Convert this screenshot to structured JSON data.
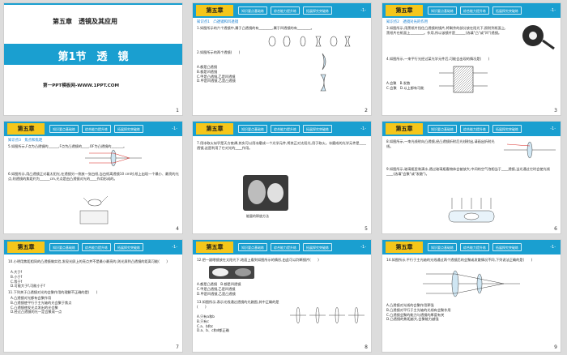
{
  "common": {
    "chapter_badge": "第五章",
    "tab1": "知识要点基础练",
    "tab2": "综合能力提升练",
    "tab3": "拓展探究突破练",
    "page_marker": "-1-"
  },
  "slides": [
    {
      "number": "1",
      "chapter_title": "第五章　透镜及其应用",
      "section_title": "第1节　透　镜",
      "footer": "第一PPT模板网-WWW.1PPT.COM"
    },
    {
      "number": "2",
      "topic": "知识点1　凸透镜和凹透镜",
      "q1": "1.如图所示的六个透镜中,属于凸透镜的有________,属于凹透镜的有________。",
      "q2": "2.如图所示的两个透镜(　　)",
      "opts": "A.都是凸透镜\nB.都是凹透镜\nC.甲是凸透镜,乙是凹透镜\nD.甲是凹透镜,乙是凸透镜"
    },
    {
      "number": "3",
      "topic": "知识点2　透镜对光的作用",
      "q3": "3.如图所示,用黑纸片挡住凸透镜的镜片,将剩余的部分放在阳光下,照射到纸面上,黑纸片在纸面上________。作用,所以该镜片是______(选填\"凸\"或\"凹\")透镜。",
      "q4": "4.如图所示,一束平行光经过某光学元件后,可能会出现的情况是(　　)",
      "opts": "A.会聚　B.发散\nC.会聚　D.以上都有可能"
    },
    {
      "number": "4",
      "topic": "知识点3　焦点和焦距",
      "q5": "5.如图所示,F点为凸透镜的______,F点为凸透镜的____,OF为凸透镜的_______。",
      "q6": "6.如图所示,用凸透镜正对着太阳光,在透镜另一侧放一张白纸,当白纸离透镜10 cm时,纸上出现一个最小、最亮的光点,则透镜的焦距约为______cm,光点是由凸透镜对光的____作用形成的。"
    },
    {
      "number": "5",
      "q7": "7.用冰取火似乎是天方夜谭,其实可以用冰磨成一个光学元件,将其正对太阳光,用于取火。冰磨成的光学元件是____透镜,这是利用了它对光的____作用。",
      "caption": "能量的释放方法"
    },
    {
      "number": "6",
      "q8": "8.如图所示,一束光线射向凸透镜,经凸透镜折射后光线射出,请画出折射光线。",
      "q9": "9.如图所示,玻璃瓶里装满水,透过玻璃瓶看物体会被放大,中间的空气泡相当于____透镜,当光通过它时会使光线____(选填\"会聚\"或\"发散\")。"
    },
    {
      "number": "7",
      "q10": "10.小明用焦距相同的凸透镜做实验,发现光屏上的亮点并不是最小最亮的,则光屏到凸透镜的距离可能(　　)",
      "q10opts": "A.大于f\nB.小于f\nC.等于f\nD.可能大于f,可能小于f",
      "q11": "11.下列关于凸透镜对光的会聚作用的理解不正确的是(　　)",
      "q11opts": "A.凸透镜对光都有会聚作用\nB.凸透镜使平行于主光轴的光会聚于焦点\nC.凸透镜使发光点发出的光会聚\nD.经过凸透镜的光一定会聚成一点"
    },
    {
      "number": "8",
      "q12": "12.把一副眼镜放在太阳光下,地面上看到如图所示的情形,由此可以判断镜片(　　)",
      "q12opts": "A.都是凸透镜　B.都是凹透镜\nC.甲是凸透镜,乙是凹透镜\nD.甲是凹透镜,乙是凸透镜",
      "q13": "13.如图所示,表示光线通过透镜的光路图,其中正确的是(　　)",
      "q13opts": "A.只有a和b\nB.只有c\nC.a、b和c\nD.a、b、c和d都正确"
    },
    {
      "number": "9",
      "q14": "14.如图所示,平行于主光轴的光线通过两个透镜后的会聚或发散情况不同,下列说法正确的是(　　)",
      "q14opts": "A.凸透镜对光线的会聚作用更强\nB.凸透镜对平行于主光轴的光线有会聚作用\nC.凸透镜会聚的能力与透镜的厚度有关\nD.凸透镜的焦距越大,会聚能力越强"
    }
  ]
}
